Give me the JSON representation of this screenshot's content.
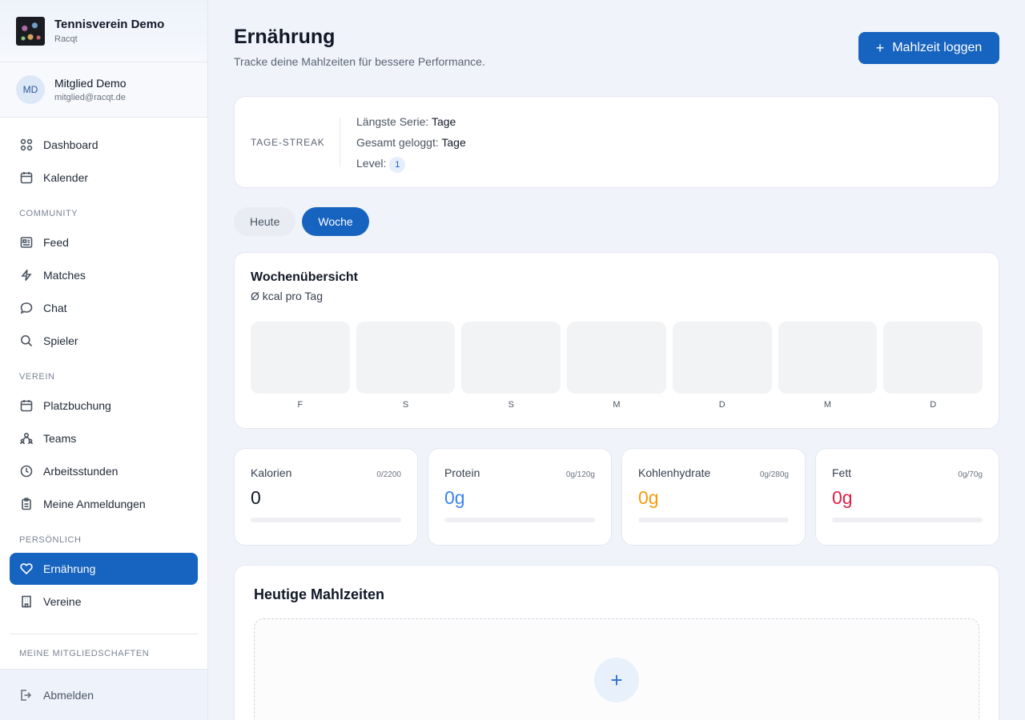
{
  "brand": {
    "name": "Tennisverein Demo",
    "sub": "Racqt"
  },
  "user": {
    "initials": "MD",
    "name": "Mitglied Demo",
    "email": "mitglied@racqt.de"
  },
  "nav": {
    "dashboard": "Dashboard",
    "kalender": "Kalender",
    "community_label": "COMMUNITY",
    "feed": "Feed",
    "matches": "Matches",
    "chat": "Chat",
    "spieler": "Spieler",
    "verein_label": "VEREIN",
    "platzbuchung": "Platzbuchung",
    "teams": "Teams",
    "arbeitsstunden": "Arbeitsstunden",
    "anmeldungen": "Meine Anmeldungen",
    "personal_label": "PERSÖNLICH",
    "ernaehrung": "Ernährung",
    "vereine": "Vereine",
    "memberships_label": "MEINE MITGLIEDSCHAFTEN",
    "logout": "Abmelden"
  },
  "page": {
    "title": "Ernährung",
    "subtitle": "Tracke deine Mahlzeiten für bessere Performance.",
    "log_button": "Mahlzeit loggen"
  },
  "streak": {
    "label": "TAGE-STREAK",
    "longest_label": "Längste Serie:",
    "longest_value": "Tage",
    "total_label": "Gesamt geloggt:",
    "total_value": "Tage",
    "level_label": "Level:",
    "level_value": "1"
  },
  "tabs": {
    "today": "Heute",
    "week": "Woche"
  },
  "week": {
    "title": "Wochenübersicht",
    "subtitle": "Ø kcal pro Tag",
    "days": [
      "F",
      "S",
      "S",
      "M",
      "D",
      "M",
      "D"
    ]
  },
  "stats": [
    {
      "name": "Kalorien",
      "goal": "0/2200",
      "value": "0",
      "color": "#111827"
    },
    {
      "name": "Protein",
      "goal": "0g/120g",
      "value": "0g",
      "color": "#3b82f6"
    },
    {
      "name": "Kohlenhydrate",
      "goal": "0g/280g",
      "value": "0g",
      "color": "#f59e0b"
    },
    {
      "name": "Fett",
      "goal": "0g/70g",
      "value": "0g",
      "color": "#e11d48"
    }
  ],
  "meals": {
    "title": "Heutige Mahlzeiten",
    "add_symbol": "+"
  },
  "colors": {
    "accent": "#1763c0",
    "background": "#f0f4fa"
  }
}
